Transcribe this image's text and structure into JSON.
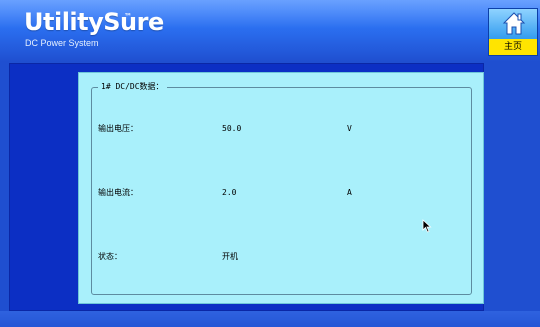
{
  "header": {
    "brand": "UtilitySure",
    "trademark": "™",
    "subtitle": "DC Power System",
    "home_label": "主页"
  },
  "panel": {
    "legend": "1# DC/DC数据：",
    "rows": [
      {
        "label": "输出电压：",
        "value": "50.0",
        "unit": "V"
      },
      {
        "label": "输出电流：",
        "value": "2.0",
        "unit": "A"
      },
      {
        "label": "状态：",
        "value": "开机",
        "unit": ""
      }
    ]
  },
  "colors": {
    "header_blue": "#2b6ff0",
    "main_blue": "#0c2fc4",
    "panel_cyan": "#a9f0fb",
    "home_label_yellow": "#ffe400"
  },
  "icons": {
    "home": "home-icon",
    "cursor": "mouse-pointer-icon"
  }
}
